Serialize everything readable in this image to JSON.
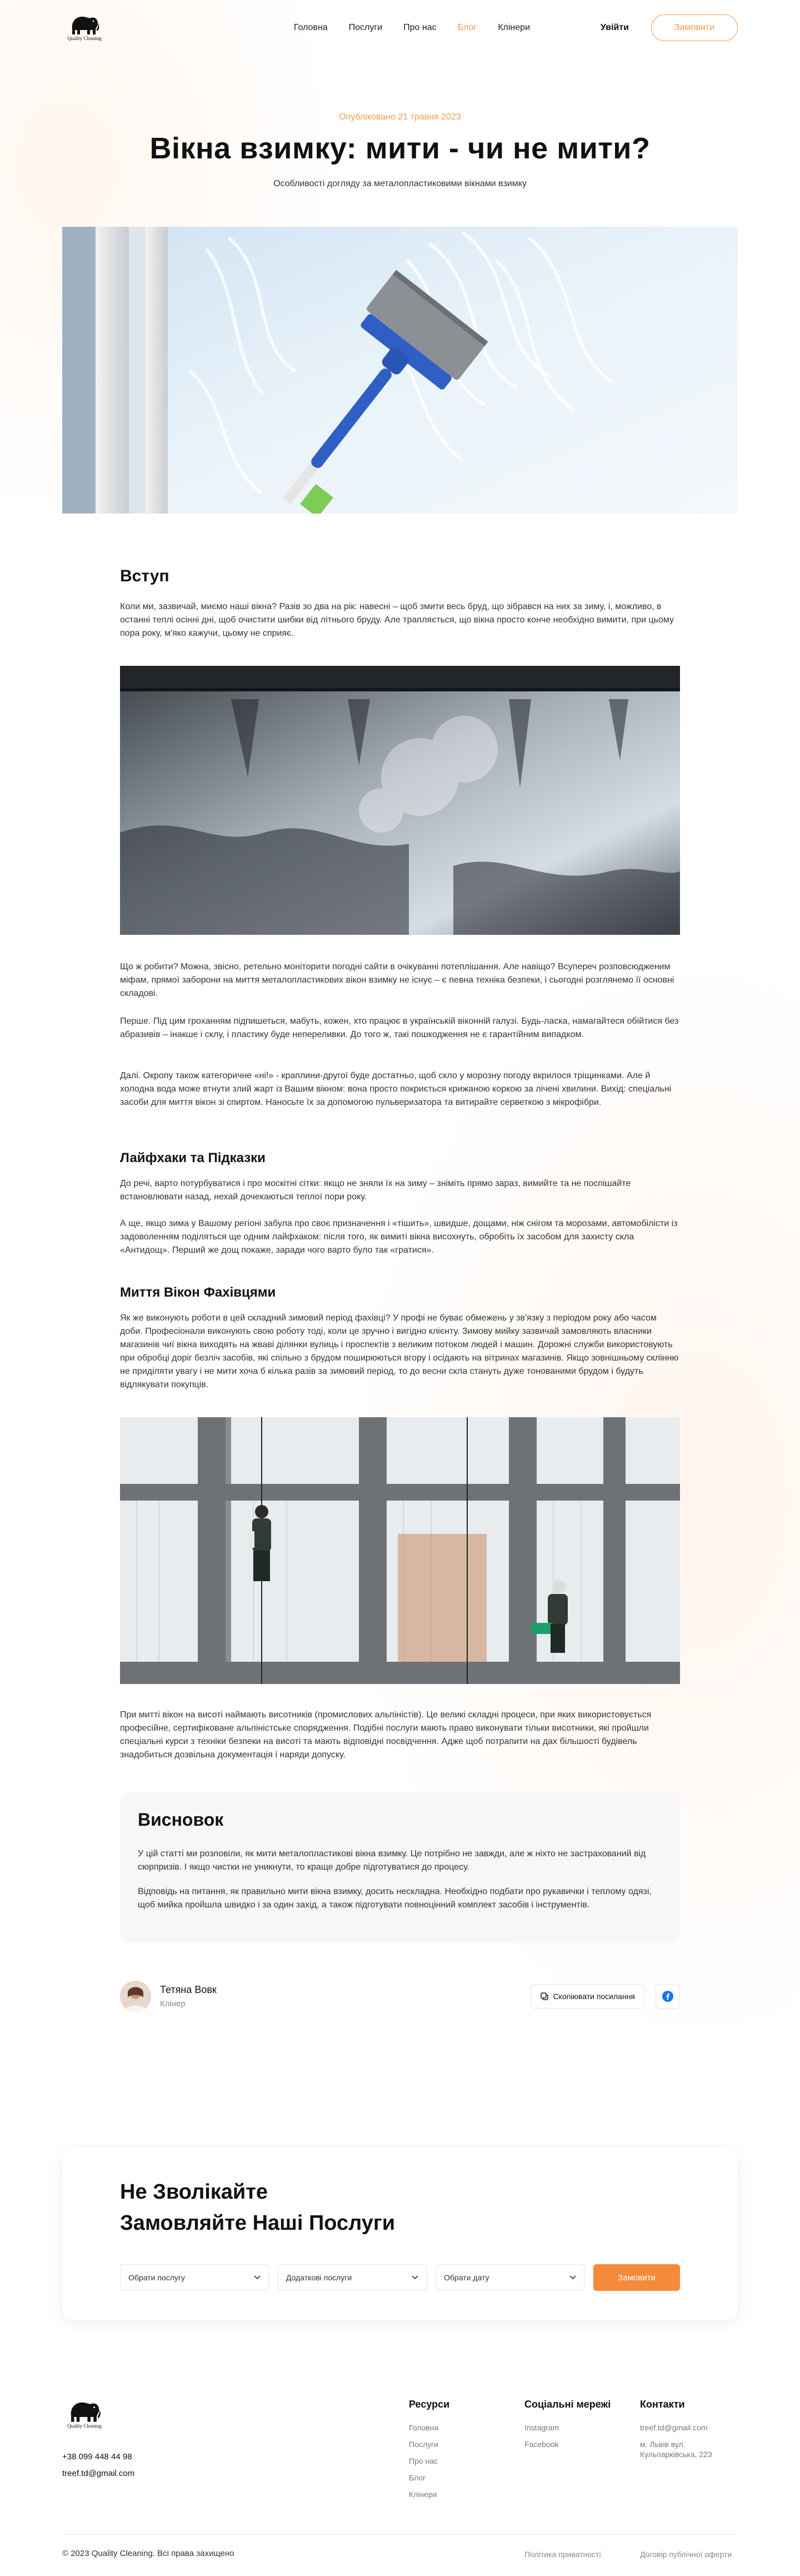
{
  "colors": {
    "accent": "#f59a4b",
    "accent_fill": "#f58a3a",
    "facebook": "#1877f2"
  },
  "header": {
    "logo_text": "Quality Cleaning",
    "nav": [
      "Головна",
      "Послуги",
      "Про нас",
      "Блог",
      "Клінери"
    ],
    "active_nav": "Блог",
    "login": "Увійти",
    "order": "Замовити"
  },
  "hero": {
    "published": "Опубліковано 21 травня 2023",
    "title": "Вікна взимку: мити - чи не мити?",
    "subtitle": "Особливості догляду за металопластиковими вікнами взимку"
  },
  "article": {
    "intro_heading": "Вступ",
    "intro_p": "Коли ми, зазвичай, миємо наші вікна? Разів зо два на рік: навесні – щоб змити весь бруд, що зібрався на них за зиму, і, можливо, в останні теплі осінні дні, щоб очистити шибки від літнього бруду. Але трапляється, що вікна просто конче необхідно вимити, при цьому пора року, м'яко кажучи, цьому не сприяє.",
    "p2": "Що ж робити? Можна, звісно, ретельно моніторити погодні сайти в очікуванні потеплішання. Але навіщо? Всупереч розповсюдженим міфам, прямої заборони на миття металопластикових вікон взимку не існує – є певна техніка безпеки, і сьогодні розглянемо її основні складові.",
    "p3": "Перше. Під цим гроханням підпишеться, мабуть, кожен, хто працює в українській віконній галузі. Будь-ласка, намагайтеся обійтися без абразивів – інакше і склу, і пластику буде непереливки. До того ж, такі пошкодження не є гарантійним випадком.",
    "p4": "Далі. Окропу також категоричне «ні!» - краплини-другої буде достатньо, щоб скло у морозну погоду вкрилося тріщинками. Але й холодна вода може втнути злий жарт із Вашим вікном: вона просто покриється крижаною коркою за лічені хвилини. Вихід: спеціальні засоби для миття вікон зі спиртом. Наносьте їх за допомогою пульверизатора та витирайте серветкою з мікрофібри.",
    "tips_heading": "Лайфхаки та Підказки",
    "tips_p1": "До речі, варто потурбуватися і про москітні сітки: якщо не зняли їх на зиму – зніміть прямо зараз, вимийте та не поспішайте встановлювати назад, нехай дочекаються теплої пори року.",
    "tips_p2": "А ще, якщо зима у Вашому регіоні забула про своє призначення і «тішить», швидше, дощами, ніж снігом та морозами, автомобілісти із задоволенням поділяться ще одним лайфхаком: після того, як вимиті вікна висохнуть, обробіть їх засобом для захисту скла «Антидощ». Перший же дощ покаже, заради чого варто було так «гратися».",
    "pro_heading": "Миття Вікон Фахівцями",
    "pro_p1": "Як же виконують роботи в цей складний зимовий період фахівці? У профі не буває обмежень у зв'язку з періодом року або часом доби. Професіонали виконують свою роботу тоді, коли це зручно і вигідно клієнту. Зимову мийку зазвичай замовляють власники магазинів чиї вікна виходять на жваві ділянки вулиць і проспектів з великим потоком людей і машин. Дорожні служби використовують при обробці доріг безліч засобів, які спільно з брудом поширюються вгору і осідають на вітринах магазинів. Якщо зовнішньому склінню не приділяти увагу і не мити хоча б кілька разів за зимовий період, то до весни скла стануть дуже тонованими брудом і будуть відлякувати покупців.",
    "pro_p2": "При митті вікон на висоті наймають висотників (промислових альпіністів). Це великі складні процеси, при яких використовується професійне, сертифіковане альпіністське спорядження. Подібні послуги мають право виконувати тільки висотники, які пройшли спеціальні курси з техніки безпеки на висоті та мають відповідні посвідчення. Адже щоб потрапити на дах більшості будівель знадобиться дозвільна документація і наряди допуску."
  },
  "conclusion": {
    "heading": "Висновок",
    "p1": "У цій статті ми розповіли, як мити металопластикові вікна взимку. Це потрібно не завжди, але ж ніхто не застрахований від сюрпризів. І якщо чистки не уникнути, то краще добре підготуватися до процесу.",
    "p2": "Відповідь на питання, як правильно мити вікна взимку, досить нескладна. Необхідно подбати про рукавички і теплому одязі, щоб мийка пройшла швидко і за один захід, а також підготувати повноцінний комплект засобів і інструментів."
  },
  "author": {
    "name": "Тетяна Вовк",
    "role": "Клінер",
    "copy_link": "Скопіювати посилання"
  },
  "cta": {
    "title_line1": "Не Зволікайте",
    "title_line2": "Замовляйте Наші Послуги",
    "select_service": "Обрати послугу",
    "select_extra": "Додаткові послуги",
    "select_date": "Обрати дату",
    "submit": "Замовити"
  },
  "footer": {
    "phone": "+38 099 448 44 98",
    "email": "treef.td@gmail.com",
    "resources_title": "Ресурси",
    "resources": [
      "Головна",
      "Послуги",
      "Про нас",
      "Блог",
      "Клінери"
    ],
    "social_title": "Соціальні мережі",
    "social": [
      "Instagram",
      "Facebook"
    ],
    "contacts_title": "Контакти",
    "contact_email": "treef.td@gmail.com",
    "contact_addr1": "м. Львів вул.",
    "contact_addr2": "Кульпарківська, 223",
    "copyright": "© 2023 Quality Cleaning. Всі права захищено",
    "privacy": "Політика приватності",
    "offer": "Договір публічної оферти"
  }
}
